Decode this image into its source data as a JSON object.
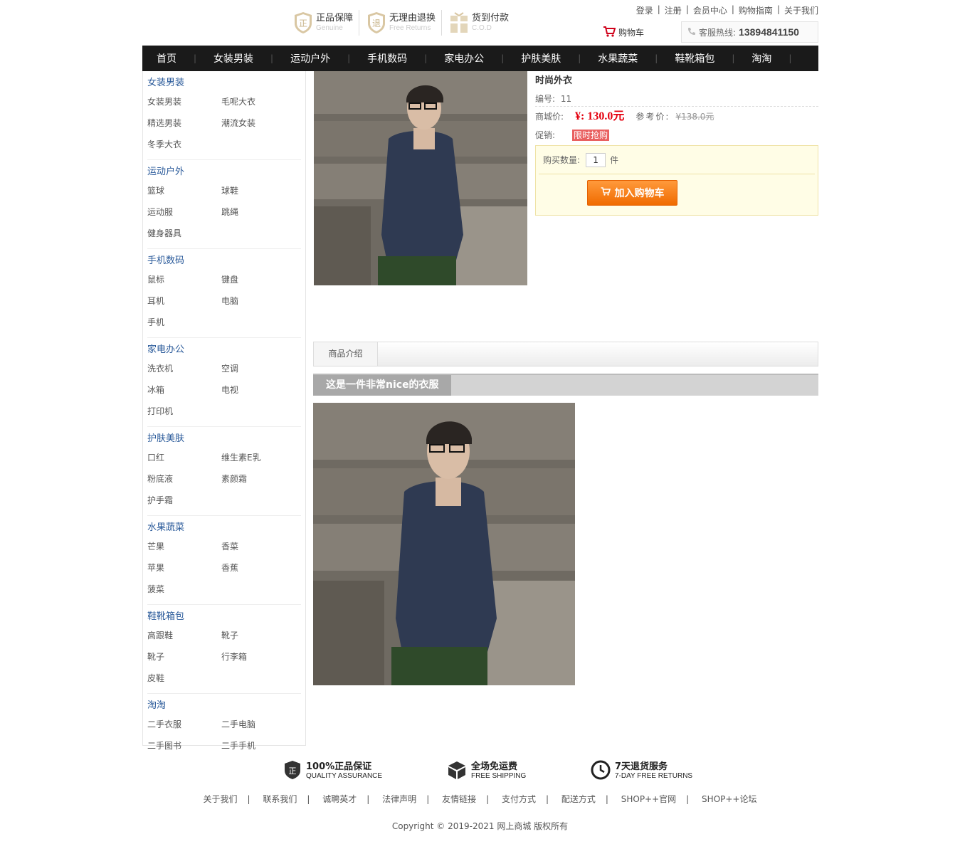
{
  "header": {
    "badges": [
      {
        "title": "正品保障",
        "sub": "Genuine",
        "icon": "genuine-icon"
      },
      {
        "title": "无理由退换",
        "sub": "Free Returns",
        "icon": "returns-icon"
      },
      {
        "title": "货到付款",
        "sub": "C.O.D",
        "icon": "cod-icon"
      }
    ],
    "toplinks": [
      "登录",
      "注册",
      "会员中心",
      "购物指南",
      "关于我们"
    ],
    "cart_label": "购物车",
    "hotline_label": "客服热线:",
    "hotline_number": "13894841150"
  },
  "nav": [
    "首页",
    "女装男装",
    "运动户外",
    "手机数码",
    "家电办公",
    "护肤美肤",
    "水果蔬菜",
    "鞋靴箱包",
    "淘淘"
  ],
  "sidebar": [
    {
      "title": "女装男装",
      "items": [
        "女装男装",
        "毛呢大衣",
        "精选男装",
        "潮流女装",
        "冬季大衣"
      ]
    },
    {
      "title": "运动户外",
      "items": [
        "篮球",
        "球鞋",
        "运动服",
        "跳绳",
        "健身器具"
      ]
    },
    {
      "title": "手机数码",
      "items": [
        "鼠标",
        "键盘",
        "耳机",
        "电脑",
        "手机"
      ]
    },
    {
      "title": "家电办公",
      "items": [
        "洗衣机",
        "空调",
        "冰箱",
        "电视",
        "打印机"
      ]
    },
    {
      "title": "护肤美肤",
      "items": [
        "口红",
        "维生素E乳",
        "粉底液",
        "素颜霜",
        "护手霜"
      ]
    },
    {
      "title": "水果蔬菜",
      "items": [
        "芒果",
        "香菜",
        "苹果",
        "香蕉",
        "菠菜"
      ]
    },
    {
      "title": "鞋靴箱包",
      "items": [
        "高跟鞋",
        "靴子",
        "靴子",
        "行李箱",
        "皮鞋"
      ]
    },
    {
      "title": "淘淘",
      "items": [
        "二手衣服",
        "二手电脑",
        "二手图书",
        "二手手机"
      ]
    }
  ],
  "product": {
    "name": "时尚外衣",
    "id_label": "编号:",
    "id_value": "11",
    "price_label": "商城价:",
    "price": "¥: 130.0元",
    "ref_label": "参考价:",
    "ref_price": "¥138.0元",
    "promo_label": "促销:",
    "promo_tag": "限时抢购",
    "qty_label": "购买数量:",
    "qty_value": "1",
    "qty_unit": "件",
    "add_cart": "加入购物车"
  },
  "tabs": [
    "商品介绍"
  ],
  "description_title": "这是一件非常nice的衣服",
  "footer": {
    "guarantees": [
      {
        "title": "100%正品保证",
        "sub": "QUALITY ASSURANCE",
        "icon": "shield-icon"
      },
      {
        "title": "全场免运费",
        "sub": "FREE SHIPPING",
        "icon": "box-icon"
      },
      {
        "title": "7天退货服务",
        "sub": "7-DAY FREE RETURNS",
        "icon": "clock-icon"
      }
    ],
    "links": [
      "关于我们",
      "联系我们",
      "诚聘英才",
      "法律声明",
      "友情链接",
      "支付方式",
      "配送方式",
      "SHOP++官网",
      "SHOP++论坛"
    ],
    "copyright": "Copyright © 2019-2021 网上商城 版权所有"
  },
  "colors": {
    "nav_bg": "#1a1a1a",
    "category_title": "#2a5a9a",
    "price": "#e4000f",
    "promo_tag": "#e96060",
    "add_cart": "#f57c14"
  }
}
